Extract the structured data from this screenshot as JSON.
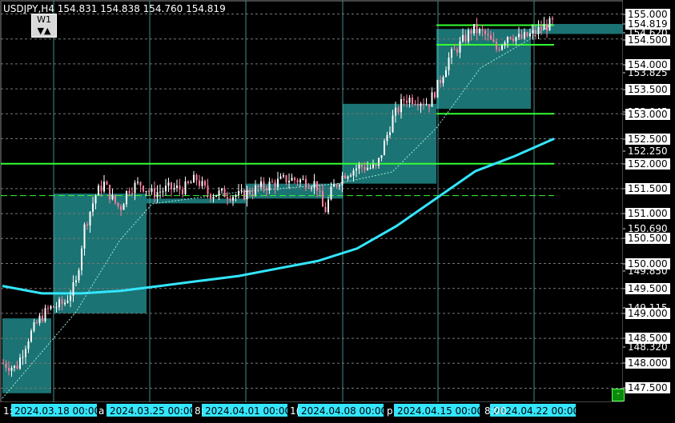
{
  "header": {
    "text": "USDJPY,H4  154.831 154.838 154.760 154.819",
    "timeframe_label": "W1",
    "timeframe_arrows": "▼▲"
  },
  "colors": {
    "background": "#000000",
    "candle_up": "#ffffff",
    "candle_down": "#ff7fa0",
    "weekly_box": "#1f7f7f",
    "level_line": "#33ff33",
    "ma_line": "#33e6ff",
    "vgrid": "#5fc9c9",
    "price_axis_bg": "#ffffff",
    "date_label_bg": "#33e6ff"
  },
  "price_axis": {
    "labels": [
      "155.000",
      "154.819",
      "154.620",
      "154.500",
      "154.000",
      "153.825",
      "153.500",
      "153.045",
      "153.000",
      "152.500",
      "152.250",
      "152.000",
      "151.500",
      "151.000",
      "150.690",
      "150.500",
      "150.000",
      "149.850",
      "149.500",
      "149.115",
      "149.000",
      "148.500",
      "148.320",
      "148.000",
      "147.500"
    ]
  },
  "time_axis": {
    "labels": [
      "2024.03.18 00:00",
      "2024.03.25 00:00",
      "2024.04.01 00:00",
      "2024.04.08 00:00",
      "2024.04.15 00:00",
      "2024.04.22 00:00"
    ],
    "partial_labels": [
      "1:",
      "a",
      "8:",
      "1(",
      "p",
      "8:00"
    ]
  },
  "minimize_button": "-",
  "chart_data": {
    "type": "candlestick",
    "title": "USDJPY,H4",
    "ylim": [
      147.3,
      155.3
    ],
    "levels": [
      155.0,
      154.4,
      153.0,
      152.0,
      151.36
    ],
    "weekly_boxes": [
      {
        "week": "2024.03.11",
        "open": 148.9,
        "close": 147.4
      },
      {
        "week": "2024.03.18",
        "open": 149.0,
        "close": 151.4
      },
      {
        "week": "2024.03.25",
        "open": 151.3,
        "close": 151.3
      },
      {
        "week": "2024.04.01",
        "open": 151.3,
        "close": 151.6
      },
      {
        "week": "2024.04.08",
        "open": 151.6,
        "close": 153.2
      },
      {
        "week": "2024.04.15",
        "open": 153.1,
        "close": 154.7
      },
      {
        "week": "2024.04.22",
        "open": 154.6,
        "close": 154.8
      }
    ],
    "moving_average": [
      149.55,
      149.4,
      149.4,
      149.45,
      149.55,
      149.65,
      149.75,
      149.9,
      150.05,
      150.3,
      150.75,
      151.3,
      151.85,
      152.15,
      152.5
    ]
  }
}
